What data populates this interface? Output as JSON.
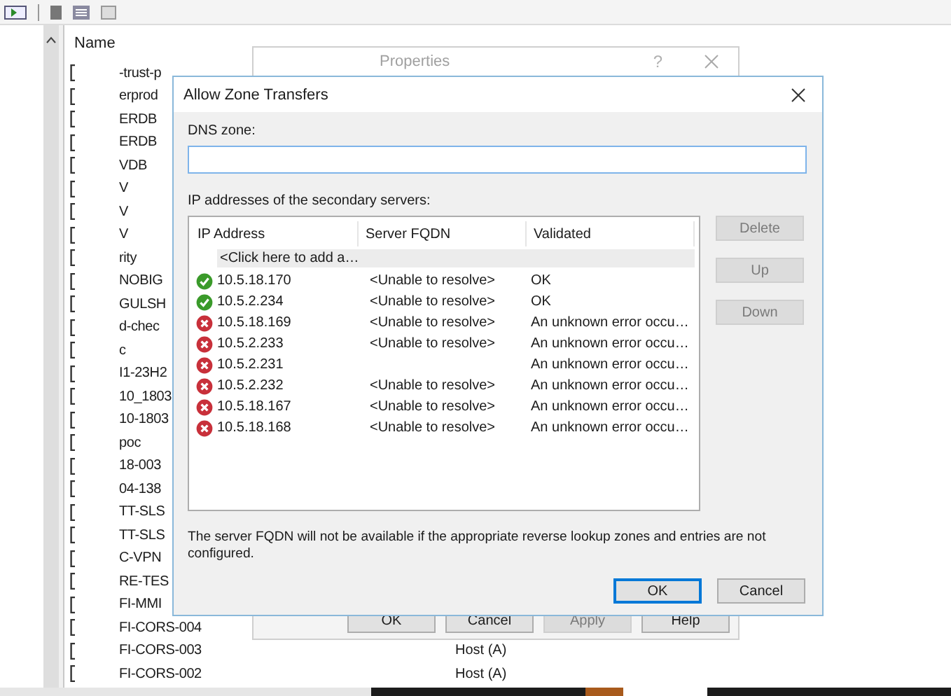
{
  "list": {
    "columns": [
      "Name"
    ],
    "rows": [
      {
        "name": "-trust-p"
      },
      {
        "name": "erprod"
      },
      {
        "name": "ERDB"
      },
      {
        "name": "ERDB"
      },
      {
        "name": "VDB"
      },
      {
        "name": "V"
      },
      {
        "name": "V"
      },
      {
        "name": "V"
      },
      {
        "name": "rity"
      },
      {
        "name": "NOBIG"
      },
      {
        "name": "GULSH"
      },
      {
        "name": "d-chec"
      },
      {
        "name": "c"
      },
      {
        "name": "I1-23H2"
      },
      {
        "name": "10_1803"
      },
      {
        "name": "10-1803"
      },
      {
        "name": "poc"
      },
      {
        "name": "18-003"
      },
      {
        "name": "04-138"
      },
      {
        "name": "TT-SLS"
      },
      {
        "name": "TT-SLS"
      },
      {
        "name": "C-VPN"
      },
      {
        "name": "RE-TES"
      },
      {
        "name": "FI-MMI"
      },
      {
        "name": "FI-CORS-004"
      },
      {
        "name": "FI-CORS-003",
        "type": "Host (A)"
      },
      {
        "name": "FI-CORS-002",
        "type": "Host (A)"
      }
    ]
  },
  "properties_window": {
    "title": "Properties",
    "help": "?",
    "buttons": [
      {
        "label": "OK",
        "disabled": false
      },
      {
        "label": "Cancel",
        "disabled": false
      },
      {
        "label": "Apply",
        "disabled": true
      },
      {
        "label": "Help",
        "disabled": false
      }
    ]
  },
  "dialog": {
    "title": "Allow Zone Transfers",
    "dns_zone_label": "DNS zone:",
    "servers_label": "IP addresses of the secondary servers:",
    "table": {
      "columns": [
        "IP Address",
        "Server FQDN",
        "Validated"
      ],
      "add_row": "<Click here to add a…",
      "rows": [
        {
          "kind": "ok",
          "ip": "10.5.18.170",
          "fqdn": "<Unable to resolve>",
          "validated": "OK"
        },
        {
          "kind": "ok",
          "ip": "10.5.2.234",
          "fqdn": "<Unable to resolve>",
          "validated": "OK"
        },
        {
          "kind": "error",
          "ip": "10.5.18.169",
          "fqdn": "<Unable to resolve>",
          "validated": "An unknown error occu…"
        },
        {
          "kind": "error",
          "ip": "10.5.2.233",
          "fqdn": "<Unable to resolve>",
          "validated": "An unknown error occu…"
        },
        {
          "kind": "error",
          "ip": "10.5.2.231",
          "validated": "An unknown error occu…"
        },
        {
          "kind": "error",
          "ip": "10.5.2.232",
          "fqdn": "<Unable to resolve>",
          "validated": "An unknown error occu…"
        },
        {
          "kind": "error",
          "ip": "10.5.18.167",
          "fqdn": "<Unable to resolve>",
          "validated": "An unknown error occu…"
        },
        {
          "kind": "error",
          "ip": "10.5.18.168",
          "fqdn": "<Unable to resolve>",
          "validated": "An unknown error occu…"
        }
      ]
    },
    "side_buttons": [
      {
        "label": "Delete",
        "disabled": true
      },
      {
        "label": "Up",
        "disabled": true
      },
      {
        "label": "Down",
        "disabled": true
      }
    ],
    "note": "The server FQDN will not be available if the appropriate reverse lookup zones and entries are not configured.",
    "buttons": [
      {
        "label": "OK",
        "default": true
      },
      {
        "label": "Cancel",
        "default": false
      }
    ]
  }
}
